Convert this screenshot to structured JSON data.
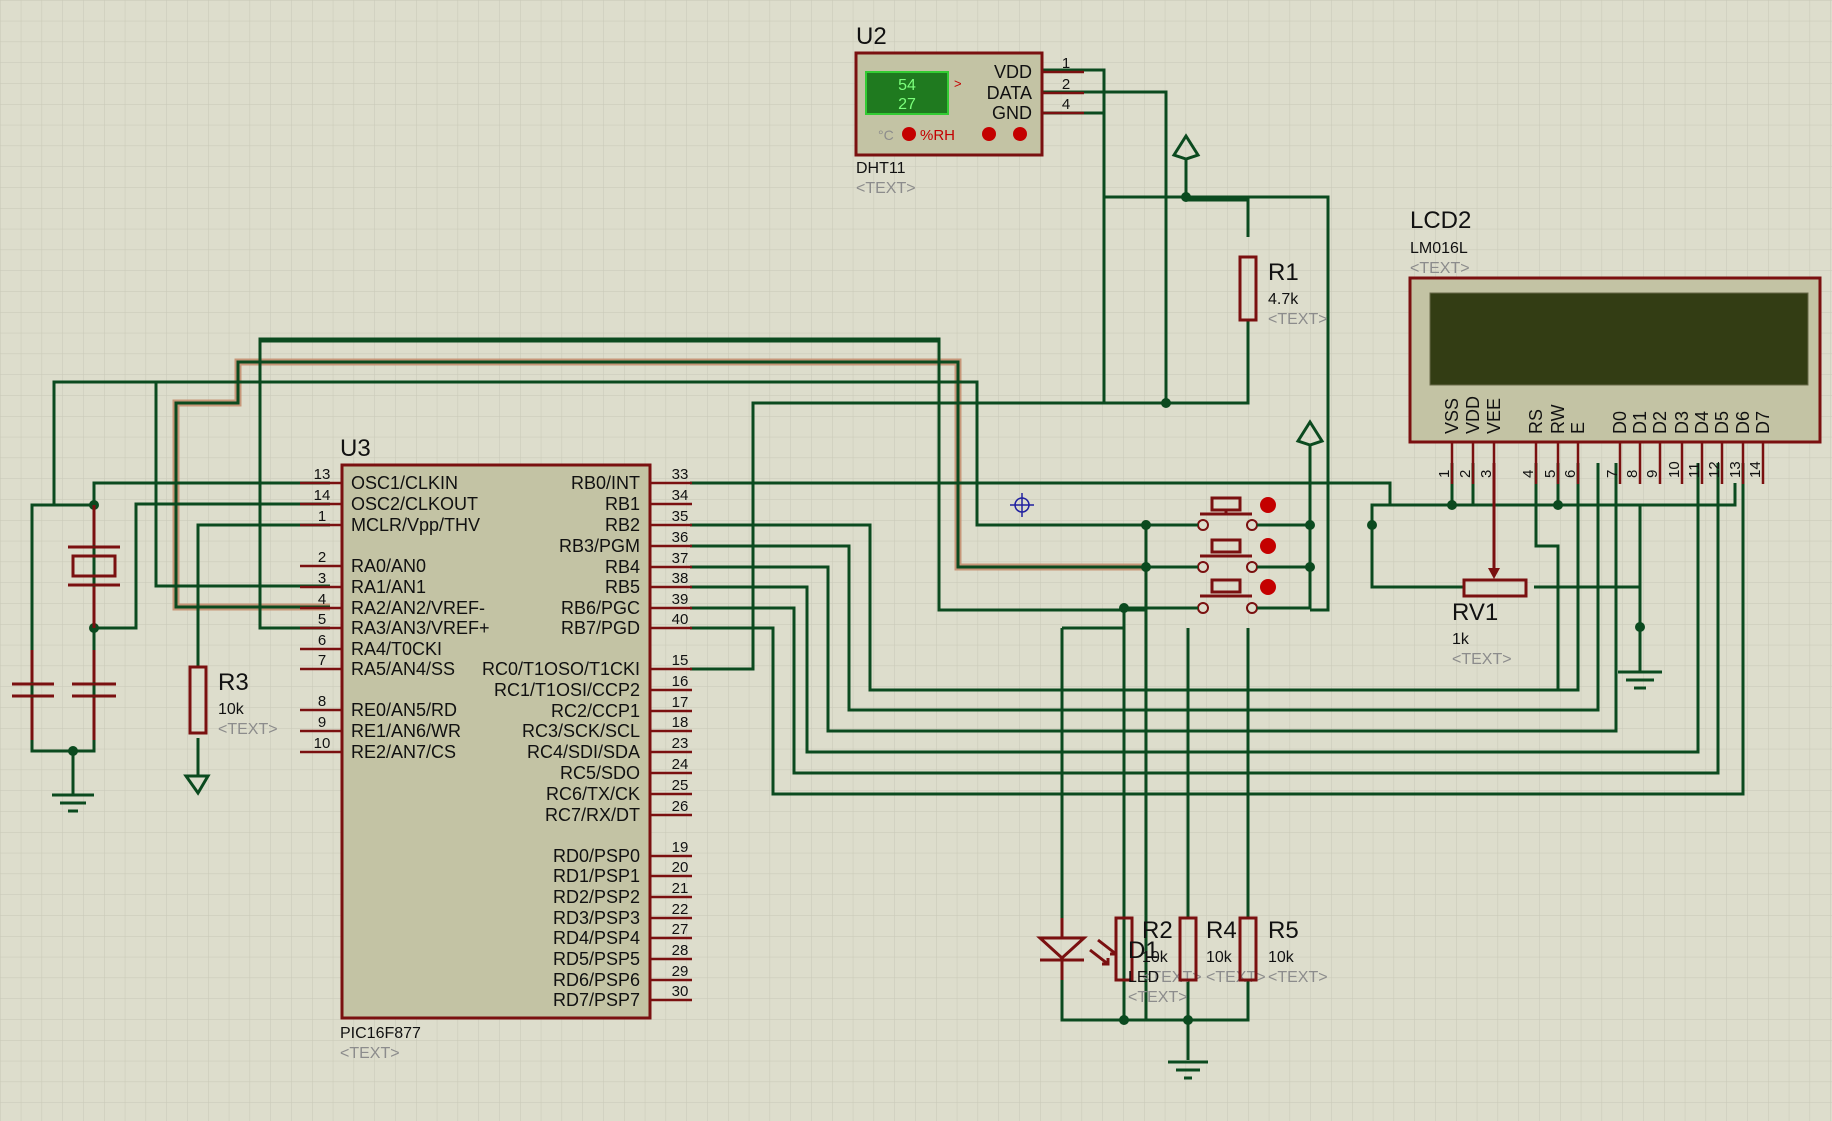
{
  "mcu": {
    "ref": "U3",
    "part": "PIC16F877",
    "text_placeholder": "<TEXT>",
    "left_pins": [
      {
        "num": "13",
        "name": "OSC1/CLKIN"
      },
      {
        "num": "14",
        "name": "OSC2/CLKOUT"
      },
      {
        "num": "1",
        "name": "MCLR/Vpp/THV"
      },
      {
        "num": "2",
        "name": "RA0/AN0"
      },
      {
        "num": "3",
        "name": "RA1/AN1"
      },
      {
        "num": "4",
        "name": "RA2/AN2/VREF-"
      },
      {
        "num": "5",
        "name": "RA3/AN3/VREF+"
      },
      {
        "num": "6",
        "name": "RA4/T0CKI"
      },
      {
        "num": "7",
        "name": "RA5/AN4/SS"
      },
      {
        "num": "8",
        "name": "RE0/AN5/RD"
      },
      {
        "num": "9",
        "name": "RE1/AN6/WR"
      },
      {
        "num": "10",
        "name": "RE2/AN7/CS"
      }
    ],
    "right_pins": [
      {
        "num": "33",
        "name": "RB0/INT"
      },
      {
        "num": "34",
        "name": "RB1"
      },
      {
        "num": "35",
        "name": "RB2"
      },
      {
        "num": "36",
        "name": "RB3/PGM"
      },
      {
        "num": "37",
        "name": "RB4"
      },
      {
        "num": "38",
        "name": "RB5"
      },
      {
        "num": "39",
        "name": "RB6/PGC"
      },
      {
        "num": "40",
        "name": "RB7/PGD"
      },
      {
        "num": "15",
        "name": "RC0/T1OSO/T1CKI"
      },
      {
        "num": "16",
        "name": "RC1/T1OSI/CCP2"
      },
      {
        "num": "17",
        "name": "RC2/CCP1"
      },
      {
        "num": "18",
        "name": "RC3/SCK/SCL"
      },
      {
        "num": "23",
        "name": "RC4/SDI/SDA"
      },
      {
        "num": "24",
        "name": "RC5/SDO"
      },
      {
        "num": "25",
        "name": "RC6/TX/CK"
      },
      {
        "num": "26",
        "name": "RC7/RX/DT"
      },
      {
        "num": "19",
        "name": "RD0/PSP0"
      },
      {
        "num": "20",
        "name": "RD1/PSP1"
      },
      {
        "num": "21",
        "name": "RD2/PSP2"
      },
      {
        "num": "22",
        "name": "RD3/PSP3"
      },
      {
        "num": "27",
        "name": "RD4/PSP4"
      },
      {
        "num": "28",
        "name": "RD5/PSP5"
      },
      {
        "num": "29",
        "name": "RD6/PSP6"
      },
      {
        "num": "30",
        "name": "RD7/PSP7"
      }
    ]
  },
  "sensor": {
    "ref": "U2",
    "part": "DHT11",
    "text_placeholder": "<TEXT>",
    "humidity": "54",
    "temperature": "27",
    "unit_c": "°C",
    "unit_rh": "%RH",
    "arrow": ">",
    "pins": [
      {
        "num": "1",
        "name": "VDD"
      },
      {
        "num": "2",
        "name": "DATA"
      },
      {
        "num": "4",
        "name": "GND"
      }
    ]
  },
  "lcd": {
    "ref": "LCD2",
    "part": "LM016L",
    "text_placeholder": "<TEXT>",
    "pins": [
      {
        "num": "1",
        "name": "VSS"
      },
      {
        "num": "2",
        "name": "VDD"
      },
      {
        "num": "3",
        "name": "VEE"
      },
      {
        "num": "4",
        "name": "RS"
      },
      {
        "num": "5",
        "name": "RW"
      },
      {
        "num": "6",
        "name": "E"
      },
      {
        "num": "7",
        "name": "D0"
      },
      {
        "num": "8",
        "name": "D1"
      },
      {
        "num": "9",
        "name": "D2"
      },
      {
        "num": "10",
        "name": "D3"
      },
      {
        "num": "11",
        "name": "D4"
      },
      {
        "num": "12",
        "name": "D5"
      },
      {
        "num": "13",
        "name": "D6"
      },
      {
        "num": "14",
        "name": "D7"
      }
    ]
  },
  "resistors": {
    "r1": {
      "ref": "R1",
      "value": "4.7k",
      "text": "<TEXT>"
    },
    "r2": {
      "ref": "R2",
      "value": "10k",
      "text": "<TEXT>"
    },
    "r3": {
      "ref": "R3",
      "value": "10k",
      "text": "<TEXT>"
    },
    "r4": {
      "ref": "R4",
      "value": "10k",
      "text": "<TEXT>"
    },
    "r5": {
      "ref": "R5",
      "value": "10k",
      "text": "<TEXT>"
    }
  },
  "pot": {
    "ref": "RV1",
    "value": "1k",
    "text": "<TEXT>"
  },
  "led": {
    "ref": "D1",
    "value": "LED",
    "text": "<TEXT>"
  },
  "colors": {
    "background": "#ddddcc",
    "grid": "#c6c6b4",
    "wire": "#0b4a1f",
    "component": "#7a1010",
    "body_fill": "#c3c3a4",
    "lcd_screen": "#333d14",
    "sensor_display": "#1f7a1f",
    "highlight_wire": "#c38a6a"
  }
}
